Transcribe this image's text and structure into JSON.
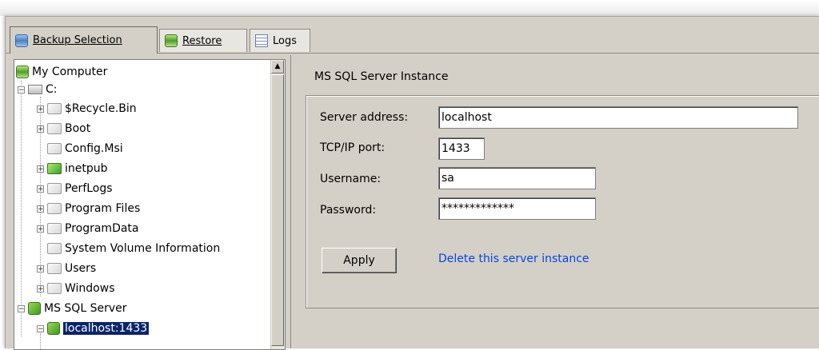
{
  "tabs": [
    {
      "label": "Backup Selection",
      "icon": "database-icon",
      "active": true
    },
    {
      "label": "Restore",
      "icon": "database-green-icon",
      "active": false
    },
    {
      "label": "Logs",
      "icon": "log-icon",
      "active": false
    }
  ],
  "tree": {
    "root": "My Computer",
    "drive": "C:",
    "folders": [
      "$Recycle.Bin",
      "Boot",
      "Config.Msi",
      "inetpub",
      "PerfLogs",
      "Program Files",
      "ProgramData",
      "System Volume Information",
      "Users",
      "Windows"
    ],
    "sql_node": "MS SQL Server",
    "sql_instance": "localhost:1433"
  },
  "panel": {
    "group_title": "MS SQL Server Instance",
    "server_address_label": "Server address:",
    "server_address_value": "localhost",
    "port_label": "TCP/IP port:",
    "port_value": "1433",
    "username_label": "Username:",
    "username_value": "sa",
    "password_label": "Password:",
    "password_value": "*************",
    "apply_label": "Apply",
    "delete_link": "Delete this server instance"
  },
  "colors": {
    "selection": "#0a246a",
    "link": "#0645dd",
    "window_bg": "#d4d0c8"
  }
}
